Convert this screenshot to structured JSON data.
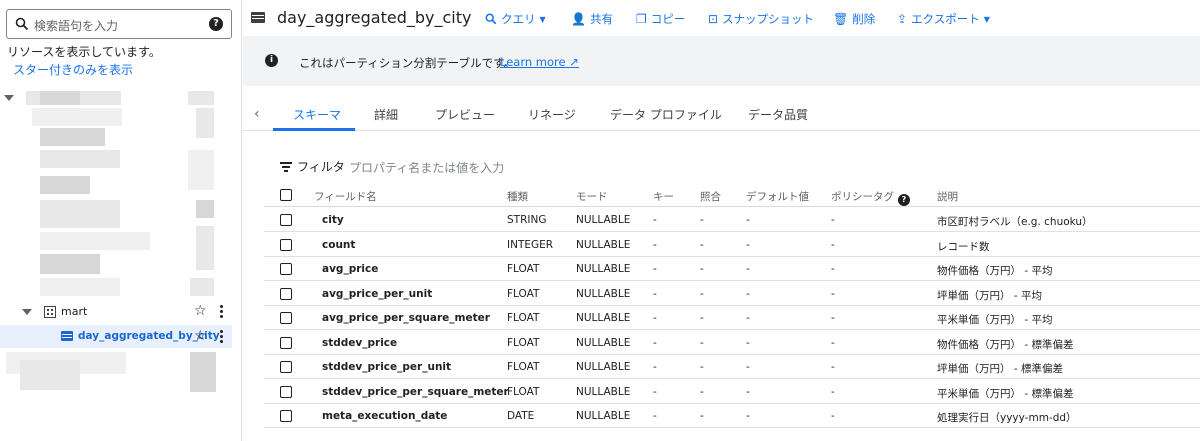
{
  "sidebar": {
    "search_placeholder": "検索語句を入力",
    "showing_resources": "リソースを表示しています。",
    "starred_only": "スター付きのみを表示",
    "dataset": "mart",
    "table": "day_aggregated_by_city"
  },
  "toolbar": {
    "title": "day_aggregated_by_city",
    "query": "クエリ",
    "share": "共有",
    "copy": "コピー",
    "snapshot": "スナップショット",
    "delete": "削除",
    "export": "エクスポート"
  },
  "banner": {
    "message": "これはパーティション分割テーブルです。",
    "learn_more": "Learn more"
  },
  "tabs": [
    "スキーマ",
    "詳細",
    "プレビュー",
    "リネージ",
    "データ プロファイル",
    "データ品質"
  ],
  "filter": {
    "label": "フィルタ",
    "placeholder": "プロパティ名または値を入力"
  },
  "schema": {
    "columns": [
      "フィールド名",
      "種類",
      "モード",
      "キー",
      "照合",
      "デフォルト値",
      "ポリシータグ",
      "説明"
    ],
    "rows": [
      {
        "name": "city",
        "type": "STRING",
        "mode": "NULLABLE",
        "key": "-",
        "collation": "-",
        "default": "-",
        "policy": "-",
        "description": "市区町村ラベル（e.g. chuoku）"
      },
      {
        "name": "count",
        "type": "INTEGER",
        "mode": "NULLABLE",
        "key": "-",
        "collation": "-",
        "default": "-",
        "policy": "-",
        "description": "レコード数"
      },
      {
        "name": "avg_price",
        "type": "FLOAT",
        "mode": "NULLABLE",
        "key": "-",
        "collation": "-",
        "default": "-",
        "policy": "-",
        "description": "物件価格（万円） - 平均"
      },
      {
        "name": "avg_price_per_unit",
        "type": "FLOAT",
        "mode": "NULLABLE",
        "key": "-",
        "collation": "-",
        "default": "-",
        "policy": "-",
        "description": "坪単価（万円） - 平均"
      },
      {
        "name": "avg_price_per_square_meter",
        "type": "FLOAT",
        "mode": "NULLABLE",
        "key": "-",
        "collation": "-",
        "default": "-",
        "policy": "-",
        "description": "平米単価（万円） - 平均"
      },
      {
        "name": "stddev_price",
        "type": "FLOAT",
        "mode": "NULLABLE",
        "key": "-",
        "collation": "-",
        "default": "-",
        "policy": "-",
        "description": "物件価格（万円） - 標準偏差"
      },
      {
        "name": "stddev_price_per_unit",
        "type": "FLOAT",
        "mode": "NULLABLE",
        "key": "-",
        "collation": "-",
        "default": "-",
        "policy": "-",
        "description": "坪単価（万円） - 標準偏差"
      },
      {
        "name": "stddev_price_per_square_meter",
        "type": "FLOAT",
        "mode": "NULLABLE",
        "key": "-",
        "collation": "-",
        "default": "-",
        "policy": "-",
        "description": "平米単価（万円） - 標準偏差"
      },
      {
        "name": "meta_execution_date",
        "type": "DATE",
        "mode": "NULLABLE",
        "key": "-",
        "collation": "-",
        "default": "-",
        "policy": "-",
        "description": "処理実行日（yyyy-mm-dd）"
      }
    ]
  }
}
